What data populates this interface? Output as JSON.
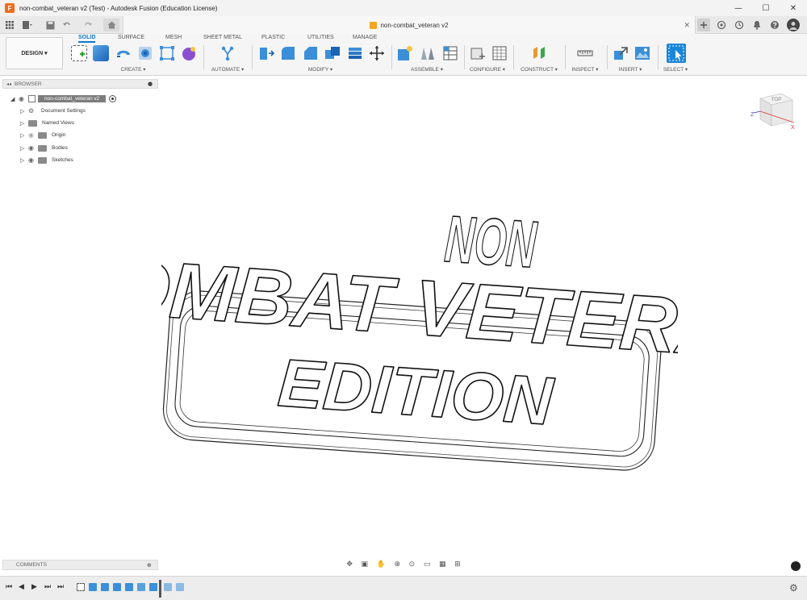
{
  "window": {
    "title": "non-combat_veteran v2 (Test) - Autodesk Fusion (Education License)",
    "logo_letter": "F",
    "controls": [
      "—",
      "☐",
      "✕"
    ]
  },
  "document_tab": {
    "label": "non-combat_veteran v2",
    "close": "✕"
  },
  "ribbon": {
    "workspace_button": "DESIGN ▾",
    "tabs": [
      "SOLID",
      "SURFACE",
      "MESH",
      "SHEET METAL",
      "PLASTIC",
      "UTILITIES",
      "MANAGE"
    ],
    "groups": [
      "CREATE ▾",
      "AUTOMATE ▾",
      "MODIFY ▾",
      "ASSEMBLE ▾",
      "CONFIGURE ▾",
      "CONSTRUCT ▾",
      "INSPECT ▾",
      "INSERT ▾",
      "SELECT ▾"
    ],
    "accent_color": "#0e7ad1"
  },
  "browser": {
    "title": "BROWSER",
    "root": "non-combat_veteran v2",
    "items": [
      "Document Settings",
      "Named Views",
      "Origin",
      "Bodies",
      "Sketches"
    ]
  },
  "viewcube": {
    "face": "TOP",
    "axis_x": "X",
    "axis_z": "Z"
  },
  "model": {
    "line1": "NON",
    "line2": "COMBAT VETERAN",
    "line3": "EDITION"
  },
  "comments": {
    "title": "COMMENTS"
  }
}
